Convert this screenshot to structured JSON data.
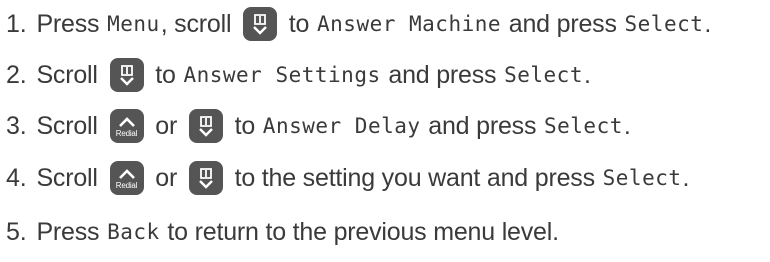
{
  "steps": [
    {
      "num": "1.",
      "parts": [
        {
          "t": "text",
          "v": "Press "
        },
        {
          "t": "lcd",
          "v": "Menu"
        },
        {
          "t": "text",
          "v": ", scroll "
        },
        {
          "t": "key",
          "icon": "phonebook-scroll-down-icon"
        },
        {
          "t": "text",
          "v": " to "
        },
        {
          "t": "lcd",
          "v": "Answer Machine"
        },
        {
          "t": "text",
          "v": " and press "
        },
        {
          "t": "lcd",
          "v": "Select"
        },
        {
          "t": "text",
          "v": "."
        }
      ]
    },
    {
      "num": "2.",
      "parts": [
        {
          "t": "text",
          "v": "Scroll "
        },
        {
          "t": "key",
          "icon": "phonebook-scroll-down-icon"
        },
        {
          "t": "text",
          "v": " to "
        },
        {
          "t": "lcd",
          "v": "Answer Settings"
        },
        {
          "t": "text",
          "v": " and press "
        },
        {
          "t": "lcd",
          "v": "Select"
        },
        {
          "t": "text",
          "v": "."
        }
      ]
    },
    {
      "num": "3.",
      "parts": [
        {
          "t": "text",
          "v": "Scroll "
        },
        {
          "t": "key",
          "icon": "redial-scroll-up-icon",
          "sub": "Redial"
        },
        {
          "t": "text",
          "v": " or "
        },
        {
          "t": "key",
          "icon": "phonebook-scroll-down-icon"
        },
        {
          "t": "text",
          "v": " to "
        },
        {
          "t": "lcd",
          "v": "Answer Delay"
        },
        {
          "t": "text",
          "v": " and press "
        },
        {
          "t": "lcd",
          "v": "Select"
        },
        {
          "t": "text",
          "v": "."
        }
      ]
    },
    {
      "num": "4.",
      "parts": [
        {
          "t": "text",
          "v": "Scroll "
        },
        {
          "t": "key",
          "icon": "redial-scroll-up-icon",
          "sub": "Redial"
        },
        {
          "t": "text",
          "v": " or "
        },
        {
          "t": "key",
          "icon": "phonebook-scroll-down-icon"
        },
        {
          "t": "text",
          "v": " to the setting you want and press "
        },
        {
          "t": "lcd",
          "v": "Select"
        },
        {
          "t": "text",
          "v": "."
        }
      ]
    },
    {
      "num": "5.",
      "parts": [
        {
          "t": "text",
          "v": "Press "
        },
        {
          "t": "lcd",
          "v": "Back"
        },
        {
          "t": "text",
          "v": " to return to the previous menu level."
        }
      ]
    }
  ],
  "colors": {
    "text": "#3a3a3a",
    "key_bg": "#555555",
    "key_fg": "#ffffff"
  }
}
